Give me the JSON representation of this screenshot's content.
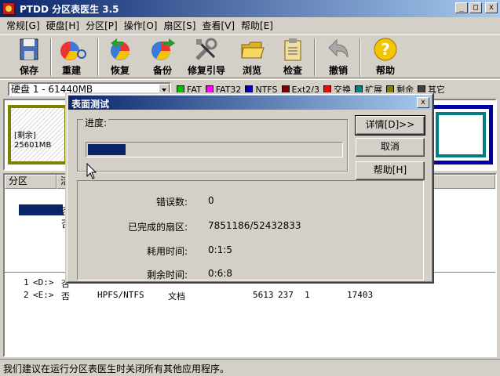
{
  "window": {
    "title": "PTDD 分区表医生 3.5",
    "minimize": "_",
    "maximize": "□",
    "close": "x"
  },
  "menu": [
    "常规[G]",
    "硬盘[H]",
    "分区[P]",
    "操作[O]",
    "扇区[S]",
    "查看[V]",
    "帮助[E]"
  ],
  "toolbar": [
    {
      "label": "保存",
      "icon": "save-icon"
    },
    {
      "label": "重建",
      "icon": "rebuild-icon"
    },
    {
      "label": "恢复",
      "icon": "restore-icon"
    },
    {
      "label": "备份",
      "icon": "backup-icon"
    },
    {
      "label": "修复引导",
      "icon": "repair-boot-icon"
    },
    {
      "label": "浏览",
      "icon": "browse-folder-icon"
    },
    {
      "label": "检查",
      "icon": "check-clipboard-icon"
    },
    {
      "label": "撤销",
      "icon": "undo-icon"
    },
    {
      "label": "帮助",
      "icon": "help-icon"
    }
  ],
  "disk_select": "硬盘 1 - 61440MB",
  "legend": [
    {
      "label": "FAT",
      "color": "#00c000"
    },
    {
      "label": "FAT32",
      "color": "#ff00ff"
    },
    {
      "label": "NTFS",
      "color": "#0000c0"
    },
    {
      "label": "Ext2/3",
      "color": "#800000"
    },
    {
      "label": "交换",
      "color": "#ff0000"
    },
    {
      "label": "扩展",
      "color": "#008080"
    },
    {
      "label": "剩余",
      "color": "#808000"
    },
    {
      "label": "其它",
      "color": "#404040"
    }
  ],
  "diskmap": {
    "free_label": "[剩余]",
    "free_size": "25601MB"
  },
  "list": {
    "header": [
      "分区",
      "活"
    ],
    "upper_rows": [
      "否",
      "否"
    ],
    "lower_rows": [
      {
        "num": "1",
        "drive": "<D:>",
        "active": "否",
        "fs": "",
        "type": "",
        "c1": "",
        "c2": "",
        "c3": "",
        "c4": ""
      },
      {
        "num": "2",
        "drive": "<E:>",
        "active": "否",
        "fs": "HPFS/NTFS",
        "type": "文档",
        "c1": "5613",
        "c2": "237",
        "c3": "1",
        "c4": "17403"
      }
    ]
  },
  "status": "我们建议在运行分区表医生时关闭所有其他应用程序。",
  "dialog": {
    "title": "表面测试",
    "close": "x",
    "progress_label": "进度:",
    "progress": 0.15,
    "stats": [
      {
        "label": "错误数:",
        "value": "0"
      },
      {
        "label": "已完成的扇区:",
        "value": "7851186/52432833"
      },
      {
        "label": "耗用时间:",
        "value": "0:1:5"
      },
      {
        "label": "剩余时间:",
        "value": "0:6:8"
      }
    ],
    "buttons": {
      "details": "详情[D]>>",
      "cancel": "取消",
      "help": "帮助[H]"
    }
  }
}
